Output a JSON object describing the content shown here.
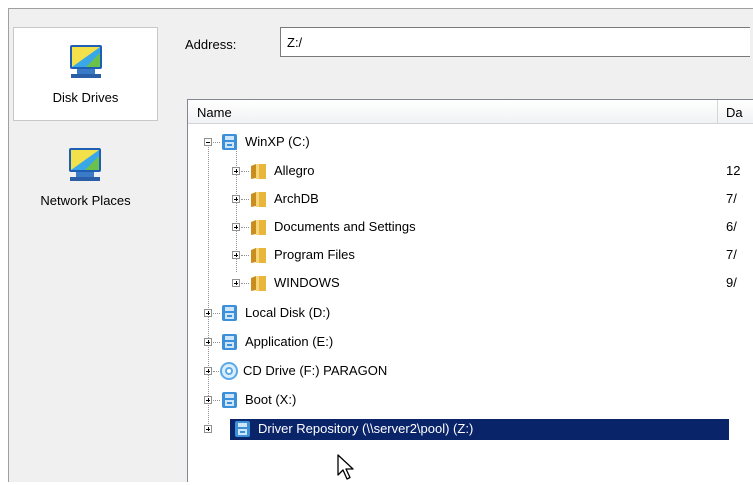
{
  "places": [
    {
      "label": "Disk Drives",
      "selected": true,
      "icon": "disk-drives-icon"
    },
    {
      "label": "Network Places",
      "selected": false,
      "icon": "network-places-icon"
    }
  ],
  "address": {
    "label": "Address:",
    "value": "Z:/"
  },
  "columns": {
    "name": "Name",
    "date": "Da"
  },
  "tree": {
    "drive_c": {
      "label": "WinXP (C:)",
      "icon": "drive-icon"
    },
    "folders": [
      {
        "label": "Allegro",
        "date": "12",
        "icon": "folder-icon"
      },
      {
        "label": "ArchDB",
        "date": "7/",
        "icon": "folder-icon"
      },
      {
        "label": "Documents and Settings",
        "date": "6/",
        "icon": "folder-icon"
      },
      {
        "label": "Program Files",
        "date": "7/",
        "icon": "folder-icon"
      },
      {
        "label": "WINDOWS",
        "date": "9/",
        "icon": "folder-icon"
      }
    ],
    "drives": [
      {
        "label": "Local Disk (D:)",
        "icon": "drive-icon"
      },
      {
        "label": "Application (E:)",
        "icon": "drive-icon"
      },
      {
        "label": "CD Drive (F:) PARAGON",
        "icon": "cd-drive-icon"
      },
      {
        "label": "Boot (X:)",
        "icon": "drive-icon"
      },
      {
        "label": "Driver Repository (\\\\server2\\pool) (Z:)",
        "icon": "network-drive-icon",
        "selected": true
      }
    ]
  },
  "colors": {
    "selection": "#0a246a",
    "drive_icon": "#3c8fd9",
    "folder": "#e9b53b"
  }
}
